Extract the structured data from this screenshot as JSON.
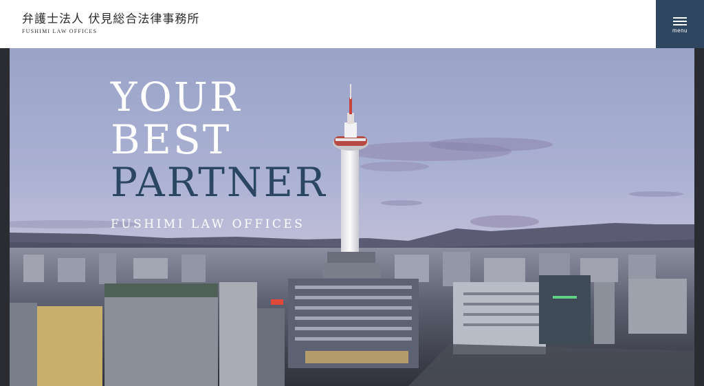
{
  "header": {
    "logo_jp": "弁護士法人 伏見総合法律事務所",
    "logo_en": "FUSHIMI LAW OFFICES",
    "menu_label": "menu"
  },
  "hero": {
    "headline_line1": "YOUR",
    "headline_line2": "BEST",
    "headline_line3": "PARTNER",
    "subtitle": "FUSHIMI LAW OFFICES"
  },
  "colors": {
    "menu_bg": "#2f4660",
    "headline_accent": "#2a4663",
    "frame": "#2a2c31"
  },
  "icons": {
    "menu": "hamburger-icon"
  }
}
